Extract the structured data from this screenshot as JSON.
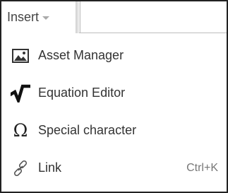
{
  "toolbar": {
    "insert_label": "Insert"
  },
  "menu": {
    "items": [
      {
        "label": "Asset Manager",
        "icon": "image-icon",
        "shortcut": ""
      },
      {
        "label": "Equation Editor",
        "icon": "square-root-icon",
        "shortcut": ""
      },
      {
        "label": "Special character",
        "icon": "omega-icon",
        "shortcut": ""
      },
      {
        "label": "Link",
        "icon": "link-icon",
        "shortcut": "Ctrl+K"
      }
    ]
  },
  "colors": {
    "text": "#333333",
    "shortcut": "#777777",
    "border": "#222222"
  }
}
